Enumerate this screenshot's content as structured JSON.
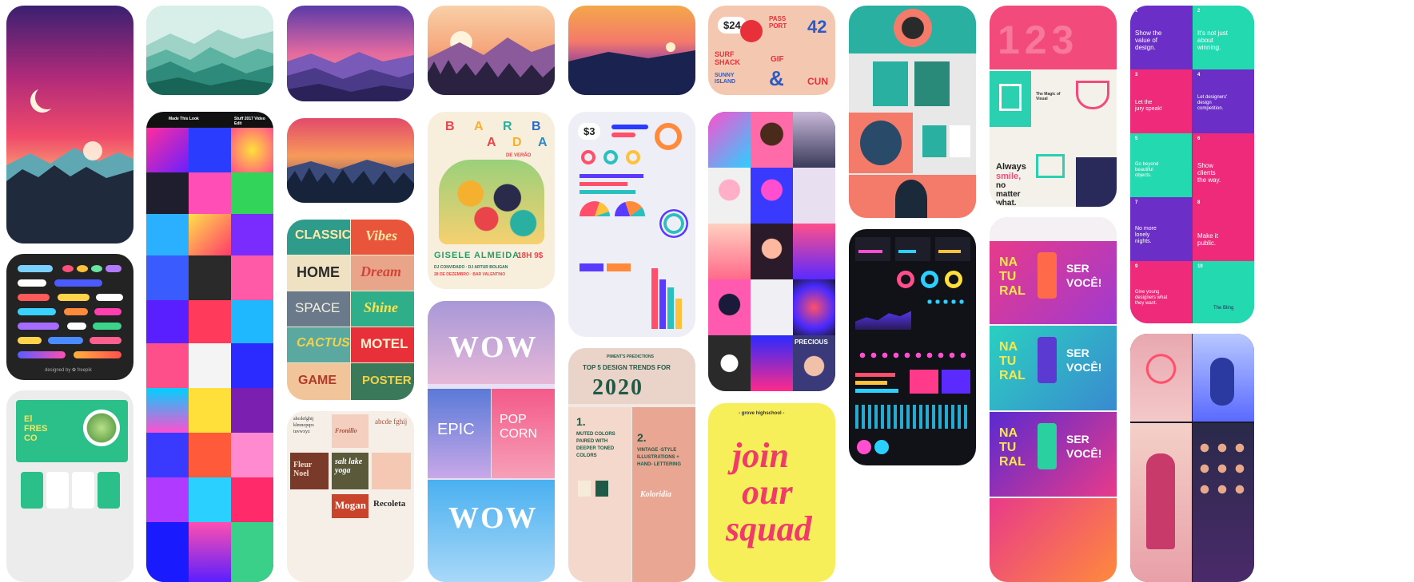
{
  "pins": {
    "moon_night": {
      "title": ""
    },
    "buttons_kit": {
      "credit": "designed by ✿ freepik"
    },
    "fresco": {
      "title": "El FRES CO"
    },
    "poster_grid": {
      "top_left": "Made This Look",
      "top_right": "Stuff 2017 Video Edit"
    },
    "retro_words": {
      "rows": [
        [
          "CLASSIC",
          "Vibes"
        ],
        [
          "HOME",
          "Dream"
        ],
        [
          "SPACE",
          "Shine"
        ],
        [
          "CACTUS",
          "MOTEL"
        ],
        [
          "GAME",
          "POSTER"
        ]
      ]
    },
    "fonts_sheet": {
      "abc1": "abcdefghij klmnopqrs tuvwxyz",
      "script1": "Fronillo",
      "abc2": "abcde fghij",
      "fleur": "Fleur Noel",
      "salt": "salt lake yoga",
      "mogan": "Mogan",
      "recoleta": "Recoleta"
    },
    "barbada": {
      "title_letters": [
        "B",
        "A",
        "R",
        "B",
        "A",
        "D",
        "A"
      ],
      "subtitle": "DE VERÃO",
      "name": "GISELE ALMEIDA",
      "time": "18H 9$",
      "line1": "DJ CONVIDADO · DJ ARTUR BOLIGAN",
      "line2": "28 DE DEZEMBRO · BAR VALENTINO"
    },
    "wow": {
      "word1": "WOW",
      "word2": "EPIC",
      "word3": "POP CORN",
      "word4": "WOW"
    },
    "infographic": {
      "price": "$3"
    },
    "trends": {
      "kicker": "PIMENT'S PREDICTIONS",
      "title": "TOP 5 DESIGN TRENDS FOR",
      "year": "2020",
      "item1_num": "1.",
      "item1": "MUTED COLORS PAIRED WITH DEEPER TONED COLORS",
      "item2_num": "2.",
      "item2": "VINTAGE -STYLE ILLUSTRATIONS + HAND- LETTERING",
      "sig": "Koloridia"
    },
    "stickers": {
      "price": "$24",
      "texts": [
        "PASS PORT",
        "42",
        "SURF SHACK",
        "GIF",
        "SUNNY ISLAND",
        "&",
        "CUN"
      ]
    },
    "faces": {
      "precious": "PRECIOUS"
    },
    "join_squad": {
      "top": "- grove highschool -",
      "line1": "join",
      "line2": "our",
      "line3": "squad"
    },
    "pantheon": {
      "title": "The Magic of Visual",
      "always": "Always",
      "smile": "smile,",
      "rest": "no matter what."
    },
    "natural": {
      "letters": "NA TU RAL",
      "ser": "SER",
      "voce": "VOCÊ!"
    },
    "purple_cards": {
      "cells": [
        {
          "num": "1",
          "text": "Show the value of design."
        },
        {
          "num": "2",
          "text": "It's not just about winning."
        },
        {
          "num": "3",
          "text": "Let the jury speak!"
        },
        {
          "num": "4",
          "text": "Let designers' design competition."
        },
        {
          "num": "5",
          "text": "Go beyond beautiful objects."
        },
        {
          "num": "6",
          "text": "Show clients the way."
        },
        {
          "num": "7",
          "text": "No more lonely nights."
        },
        {
          "num": "8",
          "text": "Make it public."
        },
        {
          "num": "9",
          "text": "Give young designers what they want."
        },
        {
          "num": "10",
          "text": "The Bling"
        }
      ]
    }
  },
  "colors": {
    "moon_sky_top": "#3d1f6b",
    "moon_sky_mid": "#e8306f",
    "purple_card": "#6b2fc8",
    "teal_card": "#23d9b0",
    "trends_pink": "#e9b4a6",
    "trends_green": "#1e5a46"
  }
}
